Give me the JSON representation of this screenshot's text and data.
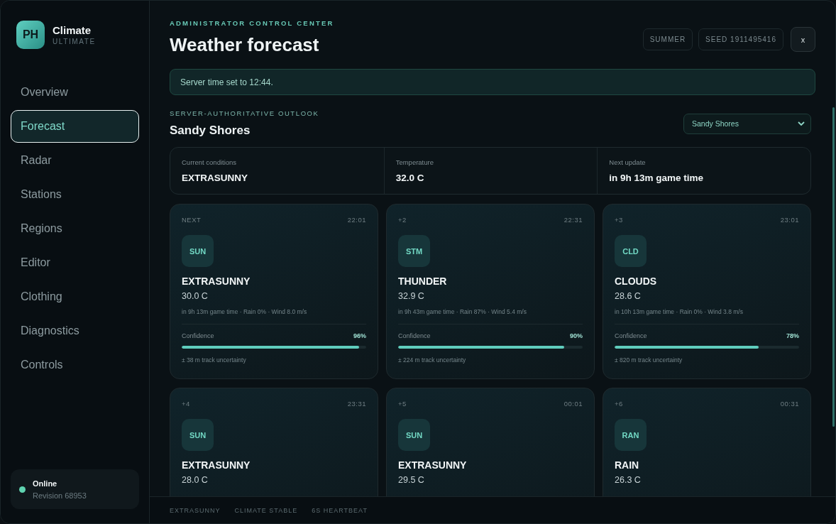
{
  "brand": {
    "logo": "PH",
    "name": "Climate",
    "edition": "ULTIMATE"
  },
  "nav": [
    {
      "label": "Overview",
      "selected": false
    },
    {
      "label": "Forecast",
      "selected": true
    },
    {
      "label": "Radar",
      "selected": false
    },
    {
      "label": "Stations",
      "selected": false
    },
    {
      "label": "Regions",
      "selected": false
    },
    {
      "label": "Editor",
      "selected": false
    },
    {
      "label": "Clothing",
      "selected": false
    },
    {
      "label": "Diagnostics",
      "selected": false
    },
    {
      "label": "Controls",
      "selected": false
    }
  ],
  "status": {
    "label": "Online",
    "revision": "Revision 68953",
    "color": "#5fd3b0"
  },
  "header": {
    "eyebrow": "ADMINISTRATOR CONTROL CENTER",
    "title": "Weather forecast",
    "chips": [
      "SUMMER",
      "SEED 1911495416"
    ],
    "close": "x"
  },
  "notice": "Server time set to 12:44.",
  "section": {
    "eyebrow": "SERVER-AUTHORITATIVE OUTLOOK",
    "title": "Sandy Shores",
    "select": "Sandy Shores"
  },
  "stats": [
    {
      "label": "Current conditions",
      "value": "EXTRASUNNY"
    },
    {
      "label": "Temperature",
      "value": "32.0 C"
    },
    {
      "label": "Next update",
      "value": "in 9h 13m game time"
    }
  ],
  "cards": [
    {
      "slot": "NEXT",
      "time": "22:01",
      "code": "SUN",
      "condition": "EXTRASUNNY",
      "temp": "30.0 C",
      "details": "in 9h 13m game time · Rain 0% · Wind 8.0 m/s",
      "confidence_label": "Confidence",
      "confidence": "96%",
      "level": 0.96,
      "uncertainty": "± 38 m track uncertainty"
    },
    {
      "slot": "+2",
      "time": "22:31",
      "code": "STM",
      "condition": "THUNDER",
      "temp": "32.9 C",
      "details": "in 9h 43m game time · Rain 87% · Wind 5.4 m/s",
      "confidence_label": "Confidence",
      "confidence": "90%",
      "level": 0.9,
      "uncertainty": "± 224 m track uncertainty"
    },
    {
      "slot": "+3",
      "time": "23:01",
      "code": "CLD",
      "condition": "CLOUDS",
      "temp": "28.6 C",
      "details": "in 10h 13m game time · Rain 0% · Wind 3.8 m/s",
      "confidence_label": "Confidence",
      "confidence": "78%",
      "level": 0.78,
      "uncertainty": "± 820 m track uncertainty"
    },
    {
      "slot": "+4",
      "time": "23:31",
      "code": "SUN",
      "condition": "EXTRASUNNY",
      "temp": "28.0 C"
    },
    {
      "slot": "+5",
      "time": "00:01",
      "code": "SUN",
      "condition": "EXTRASUNNY",
      "temp": "29.5 C"
    },
    {
      "slot": "+6",
      "time": "00:31",
      "code": "RAN",
      "condition": "RAIN",
      "temp": "26.3 C"
    }
  ],
  "footer": [
    "EXTRASUNNY",
    "CLIMATE STABLE",
    "6S HEARTBEAT"
  ]
}
